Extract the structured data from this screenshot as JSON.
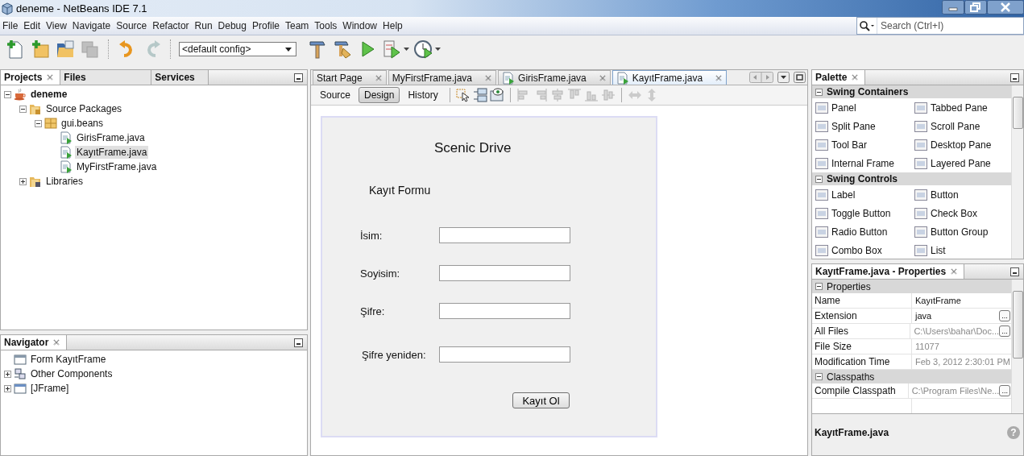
{
  "window": {
    "title": "deneme - NetBeans IDE 7.1"
  },
  "menu": [
    "File",
    "Edit",
    "View",
    "Navigate",
    "Source",
    "Refactor",
    "Run",
    "Debug",
    "Profile",
    "Team",
    "Tools",
    "Window",
    "Help"
  ],
  "toolbar": [
    {
      "kind": "new-file",
      "disabled": false,
      "dropdown": false
    },
    {
      "kind": "new-project",
      "disabled": false,
      "dropdown": false
    },
    {
      "kind": "open-project",
      "disabled": false,
      "dropdown": false
    },
    {
      "kind": "save-all",
      "disabled": true,
      "dropdown": false
    },
    {
      "kind": "separator"
    },
    {
      "kind": "undo",
      "disabled": false,
      "dropdown": false
    },
    {
      "kind": "redo",
      "disabled": true,
      "dropdown": false
    },
    {
      "kind": "separator"
    },
    {
      "kind": "select",
      "value": "<default config>"
    },
    {
      "kind": "build",
      "disabled": false,
      "dropdown": false
    },
    {
      "kind": "clean-build",
      "disabled": false,
      "dropdown": false
    },
    {
      "kind": "run",
      "disabled": false,
      "dropdown": false
    },
    {
      "kind": "debug",
      "disabled": false,
      "dropdown": true
    },
    {
      "kind": "profile",
      "disabled": false,
      "dropdown": true
    }
  ],
  "search": {
    "placeholder": "Search (Ctrl+I)"
  },
  "projects_panel": {
    "tabs": [
      {
        "label": "Projects",
        "selected": true
      },
      {
        "label": "Files",
        "selected": false
      },
      {
        "label": "Services",
        "selected": false
      }
    ],
    "tree": [
      {
        "label": "deneme",
        "kind": "project",
        "expanded": true,
        "selected": false,
        "children": [
          {
            "label": "Source Packages",
            "kind": "source-folder",
            "expanded": true,
            "selected": false,
            "children": [
              {
                "label": "gui.beans",
                "kind": "package",
                "expanded": true,
                "selected": false,
                "children": [
                  {
                    "label": "GirisFrame.java",
                    "kind": "form-file",
                    "selected": false
                  },
                  {
                    "label": "KayıtFrame.java",
                    "kind": "form-file",
                    "selected": true
                  },
                  {
                    "label": "MyFirstFrame.java",
                    "kind": "form-file",
                    "selected": false
                  }
                ]
              }
            ]
          },
          {
            "label": "Libraries",
            "kind": "library-folder",
            "expanded": false,
            "selected": false
          }
        ]
      }
    ]
  },
  "navigator": {
    "title": "Navigator",
    "tree": [
      {
        "label": "Form KayıtFrame",
        "kind": "form",
        "selected": false
      },
      {
        "label": "Other Components",
        "kind": "components",
        "expanded": false,
        "selected": false
      },
      {
        "label": "[JFrame]",
        "kind": "frame",
        "expanded": false,
        "selected": false
      }
    ]
  },
  "editor": {
    "tabs": [
      {
        "label": "Start Page",
        "icon": false,
        "selected": false
      },
      {
        "label": "MyFirstFrame.java",
        "icon": false,
        "selected": false
      },
      {
        "label": "GirisFrame.java",
        "icon": true,
        "selected": false
      },
      {
        "label": "KayıtFrame.java",
        "icon": true,
        "selected": true
      }
    ],
    "views": [
      {
        "label": "Source",
        "selected": false
      },
      {
        "label": "Design",
        "selected": true
      },
      {
        "label": "History",
        "selected": false
      }
    ],
    "tools": [
      {
        "kind": "selection-mode",
        "disabled": false
      },
      {
        "kind": "connection-mode",
        "disabled": false
      },
      {
        "kind": "preview",
        "disabled": false
      },
      {
        "kind": "separator"
      },
      {
        "kind": "align-left",
        "disabled": true
      },
      {
        "kind": "align-right",
        "disabled": true
      },
      {
        "kind": "center-horizontal",
        "disabled": true
      },
      {
        "kind": "align-top",
        "disabled": true
      },
      {
        "kind": "align-bottom",
        "disabled": true
      },
      {
        "kind": "center-vertical",
        "disabled": true
      },
      {
        "kind": "separator"
      },
      {
        "kind": "resize-horizontal",
        "disabled": true
      },
      {
        "kind": "resize-vertical",
        "disabled": true
      }
    ],
    "form": {
      "title": "Scenic Drive",
      "subtitle": "Kayıt Formu",
      "fields": [
        {
          "label": "İsim:"
        },
        {
          "label": "Soyisim:"
        },
        {
          "label": "Şifre:"
        },
        {
          "label": "Şifre yeniden:"
        }
      ],
      "button": "Kayıt Ol"
    }
  },
  "palette": {
    "title": "Palette",
    "sections": [
      {
        "title": "Swing Containers",
        "expanded": true,
        "items": [
          "Panel",
          "Tabbed Pane",
          "Split Pane",
          "Scroll Pane",
          "Tool Bar",
          "Desktop Pane",
          "Internal Frame",
          "Layered Pane"
        ]
      },
      {
        "title": "Swing Controls",
        "expanded": true,
        "items": [
          "Label",
          "Button",
          "Toggle Button",
          "Check Box",
          "Radio Button",
          "Button Group",
          "Combo Box",
          "List"
        ]
      }
    ]
  },
  "properties": {
    "title": "KayıtFrame.java - Properties",
    "sections": [
      {
        "title": "Properties",
        "expanded": true,
        "rows": [
          {
            "name": "Name",
            "value": "KayıtFrame",
            "disabled": false
          },
          {
            "name": "Extension",
            "value": "java",
            "disabled": false,
            "button": "..."
          },
          {
            "name": "All Files",
            "value": "C:\\Users\\bahar\\Doc...",
            "disabled": true,
            "button": "..."
          },
          {
            "name": "File Size",
            "value": "11077",
            "disabled": true
          },
          {
            "name": "Modification Time",
            "value": "Feb 3, 2012 2:30:01 PM",
            "disabled": true
          }
        ]
      },
      {
        "title": "Classpaths",
        "expanded": true,
        "rows": [
          {
            "name": "Compile Classpath",
            "value": "C:\\Program Files\\Ne...",
            "disabled": true,
            "button": "..."
          }
        ]
      }
    ],
    "footer": "KayıtFrame.java",
    "help": "?"
  }
}
